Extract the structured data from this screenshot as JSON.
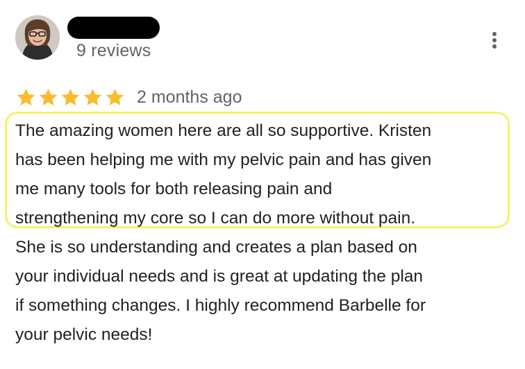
{
  "reviewer": {
    "review_count": "9 reviews"
  },
  "review": {
    "rating": 5,
    "max_rating": 5,
    "date": "2 months ago",
    "text_lines": [
      "The amazing women here are all so supportive. Kristen",
      "has been helping me with my pelvic pain and has given",
      "me many tools for both releasing pain and",
      "strengthening my core so I can do more without pain.",
      "She is so understanding and creates a plan based on",
      "your individual needs and is great at updating the plan",
      "if something changes. I highly recommend Barbelle for",
      "your pelvic needs!"
    ]
  },
  "icons": {
    "star": "star-icon",
    "menu": "more-vert-icon"
  },
  "colors": {
    "star": "#f9bc2c",
    "highlight": "#f5f26a",
    "secondary_text": "#5f6368",
    "primary_text": "#202124"
  }
}
